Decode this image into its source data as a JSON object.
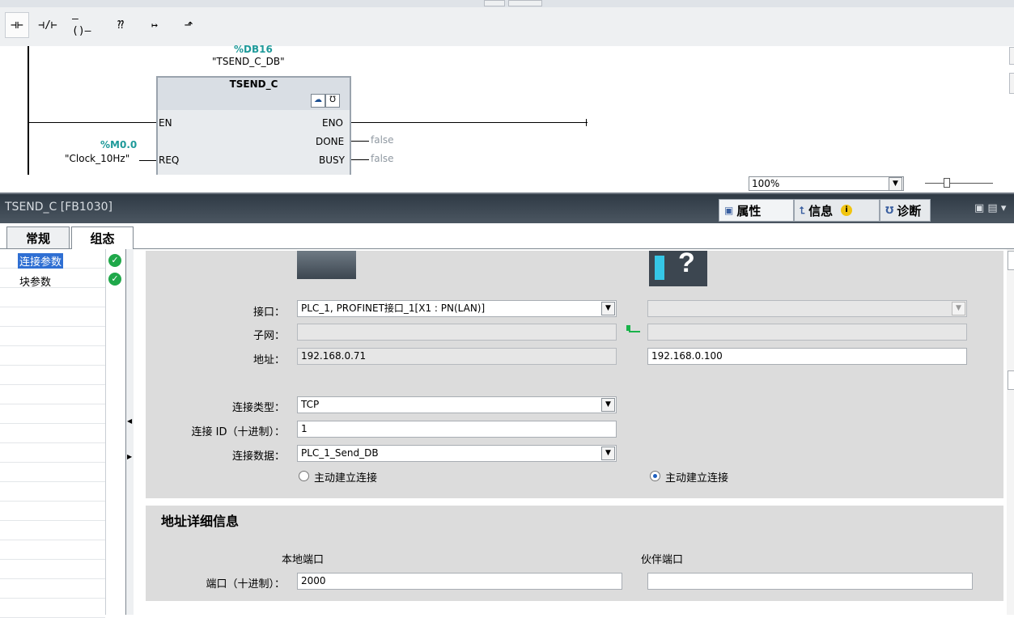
{
  "toolbar": {
    "buttons": [
      {
        "name": "contact-no-icon",
        "glyph": "⊣⊢"
      },
      {
        "name": "contact-nc-icon",
        "glyph": "⊣/⊢"
      },
      {
        "name": "coil-icon",
        "glyph": "–()–"
      },
      {
        "name": "empty-box-icon",
        "glyph": "⁇"
      },
      {
        "name": "open-branch-icon",
        "glyph": "↦"
      },
      {
        "name": "close-branch-icon",
        "glyph": "⬏"
      }
    ]
  },
  "ladder": {
    "db_address": "%DB16",
    "db_name": "\"TSEND_C_DB\"",
    "block_name": "TSEND_C",
    "pins_left": [
      "EN",
      "REQ"
    ],
    "pins_right": [
      "ENO",
      "DONE",
      "BUSY"
    ],
    "req_address": "%M0.0",
    "req_name": "\"Clock_10Hz\"",
    "done_value": "false",
    "busy_value": "false"
  },
  "zoom": {
    "value": "100%"
  },
  "panel": {
    "title": "TSEND_C [FB1030]",
    "tabs": [
      "属性",
      "信息",
      "诊断"
    ]
  },
  "subtabs": [
    "常规",
    "组态"
  ],
  "nav": {
    "items": [
      {
        "label": "连接参数",
        "status": "ok"
      },
      {
        "label": "块参数",
        "status": "ok"
      }
    ]
  },
  "config": {
    "labels": {
      "interface": "接口：",
      "subnet": "子网：",
      "address": "地址：",
      "conn_type": "连接类型：",
      "conn_id": "连接 ID（十进制）：",
      "conn_data": "连接数据："
    },
    "local": {
      "interface": "PLC_1, PROFINET接口_1[X1 : PN(LAN)]",
      "subnet": "",
      "address": "192.168.0.71",
      "radio_label": "主动建立连接",
      "radio_checked": false
    },
    "partner": {
      "interface": "",
      "subnet": "",
      "address": "192.168.0.100",
      "radio_label": "主动建立连接",
      "radio_checked": true
    },
    "conn_type": "TCP",
    "conn_id": "1",
    "conn_data": "PLC_1_Send_DB"
  },
  "address_details": {
    "title": "地址详细信息",
    "local_port_header": "本地端口",
    "partner_port_header": "伙伴端口",
    "port_label": "端口（十进制）：",
    "local_port": "2000",
    "partner_port": ""
  }
}
